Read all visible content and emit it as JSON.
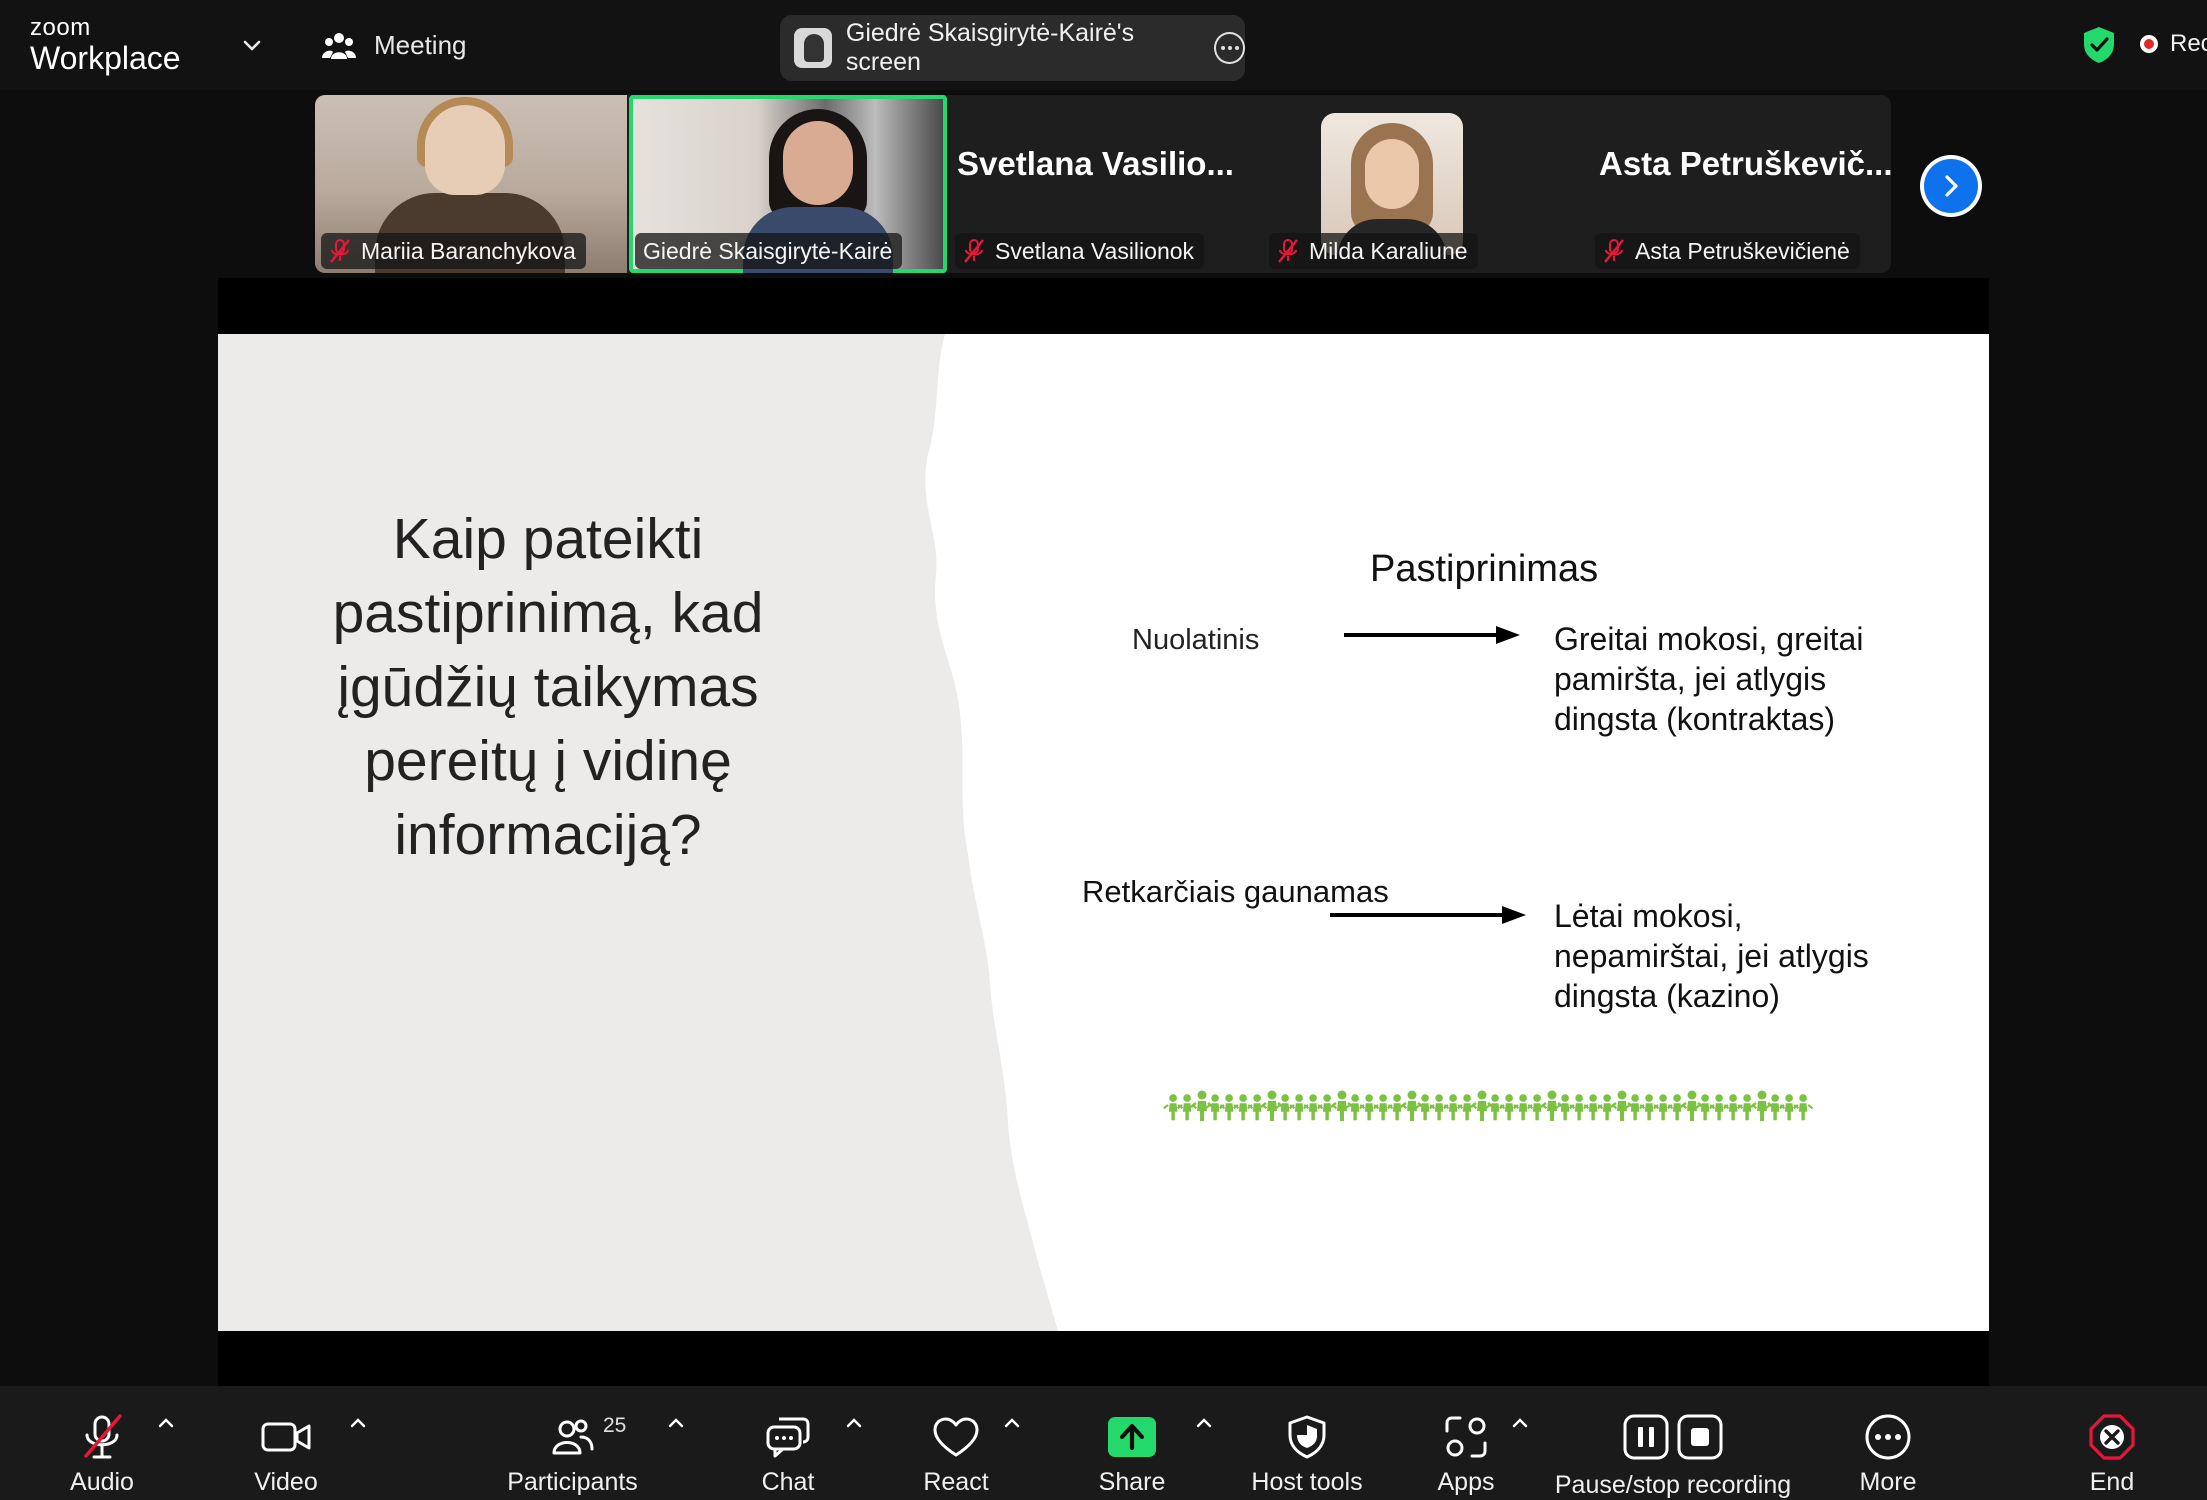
{
  "app": {
    "brand_small": "zoom",
    "brand_large": "Workplace",
    "meeting_label": "Meeting",
    "screen_share_label": "Giedrė Skaisgirytė-Kairė's screen",
    "recording_label": "Rec"
  },
  "participants": [
    {
      "name": "Mariia Baranchykova",
      "muted": true,
      "video": true
    },
    {
      "name": "Giedrė Skaisgirytė-Kairė",
      "muted": false,
      "video": true,
      "active_speaker": true
    },
    {
      "name": "Svetlana Vasilionok",
      "display_title": "Svetlana  Vasilio...",
      "muted": true,
      "video": false
    },
    {
      "name": "Milda Karaliune",
      "muted": true,
      "video": false,
      "has_photo": true
    },
    {
      "name": "Asta Petruškevičienė",
      "display_title": "Asta  Petruškevič...",
      "muted": true,
      "video": false
    }
  ],
  "slide": {
    "question_lines": [
      "Kaip pateikti",
      "pastiprinimą, kad",
      "įgūdžių taikymas",
      "pereitų į vidinę",
      "informaciją?"
    ],
    "heading": "Pastiprinimas",
    "row1_label": "Nuolatinis",
    "row1_lines": [
      "Greitai mokosi, greitai",
      "pamiršta, jei atlygis",
      "dingsta (kontraktas)"
    ],
    "row2_label": "Retkarčiais gaunamas",
    "row2_lines": [
      "Lėtai mokosi,",
      "nepamirštai, jei atlygis",
      "dingsta (kazino)"
    ]
  },
  "toolbar": {
    "audio": "Audio",
    "video": "Video",
    "participants": "Participants",
    "participants_count": "25",
    "chat": "Chat",
    "react": "React",
    "share": "Share",
    "host_tools": "Host tools",
    "apps": "Apps",
    "recording": "Pause/stop recording",
    "more": "More",
    "end": "End"
  },
  "colors": {
    "active_speaker_border": "#23d96b",
    "share_green": "#23d96b",
    "end_red": "#e8173a",
    "next_blue": "#0e72ed",
    "mute_red": "#e8173a",
    "security_green": "#23d96b"
  },
  "icons": [
    "chevron-down-icon",
    "meeting-people-icon",
    "more-icon",
    "security-shield-icon",
    "recording-dot-icon",
    "mic-muted-icon",
    "next-page-icon",
    "mic-off-icon",
    "video-icon",
    "participants-icon",
    "chat-icon",
    "react-heart-icon",
    "share-arrow-icon",
    "host-tools-shield-icon",
    "apps-icon",
    "pause-icon",
    "stop-icon",
    "more-dots-icon",
    "end-icon"
  ]
}
